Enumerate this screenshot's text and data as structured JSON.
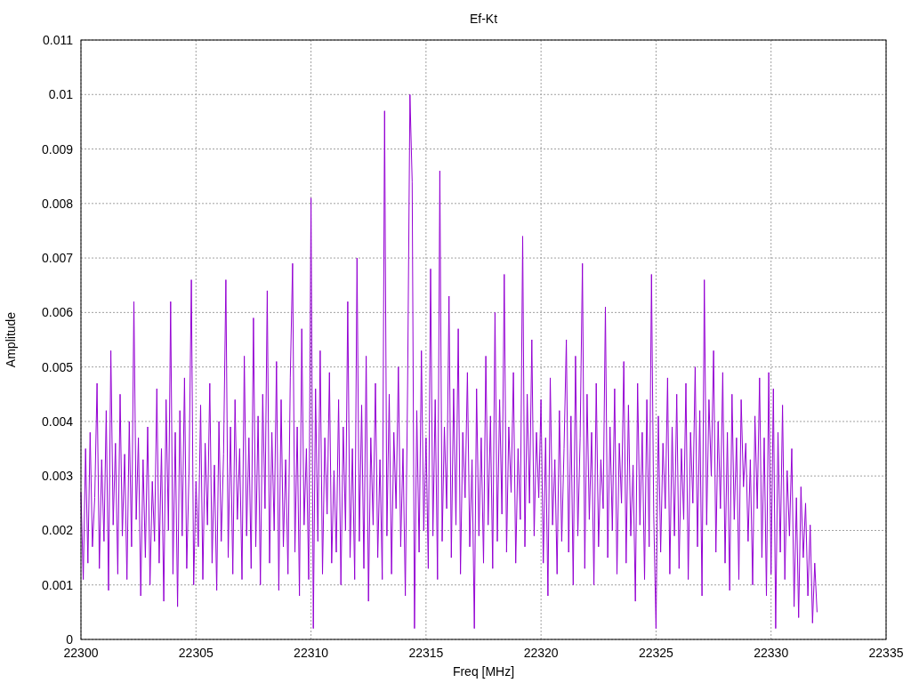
{
  "chart": {
    "chart_data": {
      "type": "line",
      "title": "Ef-Kt",
      "xlabel": "Freq [MHz]",
      "ylabel": "Amplitude",
      "grid": true,
      "xlim": [
        22300,
        22335
      ],
      "ylim": [
        0,
        0.011
      ],
      "xticks": [
        22300,
        22305,
        22310,
        22315,
        22320,
        22325,
        22330,
        22335
      ],
      "yticks": [
        0,
        0.001,
        0.002,
        0.003,
        0.004,
        0.005,
        0.006,
        0.007,
        0.008,
        0.009,
        0.01,
        0.011
      ],
      "x": [
        22300,
        22300.1,
        22300.2,
        22300.3,
        22300.4,
        22300.5,
        22300.6,
        22300.7,
        22300.8,
        22300.9,
        22301,
        22301.1,
        22301.2,
        22301.3,
        22301.4,
        22301.5,
        22301.6,
        22301.7,
        22301.8,
        22301.9,
        22302,
        22302.1,
        22302.2,
        22302.3,
        22302.4,
        22302.5,
        22302.6,
        22302.7,
        22302.8,
        22302.9,
        22303,
        22303.1,
        22303.2,
        22303.3,
        22303.4,
        22303.5,
        22303.6,
        22303.7,
        22303.8,
        22303.9,
        22304,
        22304.1,
        22304.2,
        22304.3,
        22304.4,
        22304.5,
        22304.6,
        22304.7,
        22304.8,
        22304.9,
        22305,
        22305.1,
        22305.2,
        22305.3,
        22305.4,
        22305.5,
        22305.6,
        22305.7,
        22305.8,
        22305.9,
        22306,
        22306.1,
        22306.2,
        22306.3,
        22306.4,
        22306.5,
        22306.6,
        22306.7,
        22306.8,
        22306.9,
        22307,
        22307.1,
        22307.2,
        22307.3,
        22307.4,
        22307.5,
        22307.6,
        22307.7,
        22307.8,
        22307.9,
        22308,
        22308.1,
        22308.2,
        22308.3,
        22308.4,
        22308.5,
        22308.6,
        22308.7,
        22308.8,
        22308.9,
        22309,
        22309.1,
        22309.2,
        22309.3,
        22309.4,
        22309.5,
        22309.6,
        22309.7,
        22309.8,
        22309.9,
        22310,
        22310.1,
        22310.2,
        22310.3,
        22310.4,
        22310.5,
        22310.6,
        22310.7,
        22310.8,
        22310.9,
        22311,
        22311.1,
        22311.2,
        22311.3,
        22311.4,
        22311.5,
        22311.6,
        22311.7,
        22311.8,
        22311.9,
        22312,
        22312.1,
        22312.2,
        22312.3,
        22312.4,
        22312.5,
        22312.6,
        22312.7,
        22312.8,
        22312.9,
        22313,
        22313.1,
        22313.2,
        22313.3,
        22313.4,
        22313.5,
        22313.6,
        22313.7,
        22313.8,
        22313.9,
        22314,
        22314.1,
        22314.2,
        22314.3,
        22314.4,
        22314.5,
        22314.6,
        22314.7,
        22314.8,
        22314.9,
        22315,
        22315.1,
        22315.2,
        22315.3,
        22315.4,
        22315.5,
        22315.6,
        22315.7,
        22315.8,
        22315.9,
        22316,
        22316.1,
        22316.2,
        22316.3,
        22316.4,
        22316.5,
        22316.6,
        22316.7,
        22316.8,
        22316.9,
        22317,
        22317.1,
        22317.2,
        22317.3,
        22317.4,
        22317.5,
        22317.6,
        22317.7,
        22317.8,
        22317.9,
        22318,
        22318.1,
        22318.2,
        22318.3,
        22318.4,
        22318.5,
        22318.6,
        22318.7,
        22318.8,
        22318.9,
        22319,
        22319.1,
        22319.2,
        22319.3,
        22319.4,
        22319.5,
        22319.6,
        22319.7,
        22319.8,
        22319.9,
        22320,
        22320.1,
        22320.2,
        22320.3,
        22320.4,
        22320.5,
        22320.6,
        22320.7,
        22320.8,
        22320.9,
        22321,
        22321.1,
        22321.2,
        22321.3,
        22321.4,
        22321.5,
        22321.6,
        22321.7,
        22321.8,
        22321.9,
        22322,
        22322.1,
        22322.2,
        22322.3,
        22322.4,
        22322.5,
        22322.6,
        22322.7,
        22322.8,
        22322.9,
        22323,
        22323.1,
        22323.2,
        22323.3,
        22323.4,
        22323.5,
        22323.6,
        22323.7,
        22323.8,
        22323.9,
        22324,
        22324.1,
        22324.2,
        22324.3,
        22324.4,
        22324.5,
        22324.6,
        22324.7,
        22324.8,
        22324.9,
        22325,
        22325.1,
        22325.2,
        22325.3,
        22325.4,
        22325.5,
        22325.6,
        22325.7,
        22325.8,
        22325.9,
        22326,
        22326.1,
        22326.2,
        22326.3,
        22326.4,
        22326.5,
        22326.6,
        22326.7,
        22326.8,
        22326.9,
        22327,
        22327.1,
        22327.2,
        22327.3,
        22327.4,
        22327.5,
        22327.6,
        22327.7,
        22327.8,
        22327.9,
        22328,
        22328.1,
        22328.2,
        22328.3,
        22328.4,
        22328.5,
        22328.6,
        22328.7,
        22328.8,
        22328.9,
        22329,
        22329.1,
        22329.2,
        22329.3,
        22329.4,
        22329.5,
        22329.6,
        22329.7,
        22329.8,
        22329.9,
        22330,
        22330.1,
        22330.2,
        22330.3,
        22330.4,
        22330.5,
        22330.6,
        22330.7,
        22330.8,
        22330.9,
        22331,
        22331.1,
        22331.2,
        22331.3,
        22331.4,
        22331.5,
        22331.6,
        22331.7,
        22331.8,
        22331.9,
        22332
      ],
      "series": [
        {
          "color": "#9400d3",
          "values": [
            0.0027,
            0.0011,
            0.0035,
            0.0014,
            0.0038,
            0.0017,
            0.0026,
            0.0047,
            0.0013,
            0.0033,
            0.0018,
            0.0042,
            0.0009,
            0.0053,
            0.0021,
            0.0036,
            0.0012,
            0.0045,
            0.0019,
            0.0034,
            0.0011,
            0.004,
            0.0017,
            0.0062,
            0.0022,
            0.0037,
            0.0008,
            0.0033,
            0.0015,
            0.0039,
            0.001,
            0.0029,
            0.0018,
            0.0046,
            0.0014,
            0.0035,
            0.0007,
            0.0044,
            0.002,
            0.0062,
            0.0012,
            0.0038,
            0.0006,
            0.0042,
            0.0019,
            0.0048,
            0.0013,
            0.0031,
            0.0066,
            0.001,
            0.0029,
            0.0017,
            0.0043,
            0.0011,
            0.0036,
            0.0021,
            0.0047,
            0.0014,
            0.0032,
            0.0009,
            0.004,
            0.0018,
            0.0034,
            0.0066,
            0.0015,
            0.0039,
            0.0012,
            0.0044,
            0.0022,
            0.0035,
            0.0011,
            0.0052,
            0.0019,
            0.0037,
            0.0013,
            0.0059,
            0.0017,
            0.0041,
            0.001,
            0.0045,
            0.0024,
            0.0064,
            0.0014,
            0.0038,
            0.002,
            0.0051,
            0.0009,
            0.0044,
            0.0017,
            0.0033,
            0.0012,
            0.0048,
            0.0069,
            0.0016,
            0.0039,
            0.0008,
            0.0057,
            0.0021,
            0.0035,
            0.0011,
            0.0081,
            0.0002,
            0.0046,
            0.0018,
            0.0053,
            0.0012,
            0.0037,
            0.0023,
            0.0049,
            0.0014,
            0.0031,
            0.0016,
            0.0044,
            0.001,
            0.0039,
            0.002,
            0.0062,
            0.0015,
            0.0035,
            0.0011,
            0.007,
            0.0018,
            0.0043,
            0.0013,
            0.0052,
            0.0007,
            0.0037,
            0.0021,
            0.0047,
            0.0015,
            0.0033,
            0.0011,
            0.0097,
            0.0019,
            0.0045,
            0.0012,
            0.0038,
            0.0024,
            0.005,
            0.0017,
            0.0035,
            0.0008,
            0.0047,
            0.01,
            0.0084,
            0.0002,
            0.0042,
            0.0016,
            0.0053,
            0.002,
            0.0037,
            0.0013,
            0.0068,
            0.0019,
            0.0044,
            0.0011,
            0.0086,
            0.0018,
            0.0039,
            0.0024,
            0.0063,
            0.0015,
            0.0046,
            0.0021,
            0.0057,
            0.0012,
            0.0038,
            0.0026,
            0.0049,
            0.0017,
            0.0033,
            0.0002,
            0.0046,
            0.0019,
            0.0037,
            0.0014,
            0.0052,
            0.0021,
            0.0041,
            0.0013,
            0.006,
            0.0018,
            0.0044,
            0.0023,
            0.0067,
            0.0016,
            0.0039,
            0.0027,
            0.0049,
            0.0014,
            0.0035,
            0.0022,
            0.0074,
            0.0017,
            0.0045,
            0.0025,
            0.0055,
            0.0019,
            0.0038,
            0.0026,
            0.0044,
            0.0014,
            0.0037,
            0.0008,
            0.0048,
            0.0021,
            0.0033,
            0.0012,
            0.0042,
            0.0018,
            0.0035,
            0.0055,
            0.0016,
            0.0041,
            0.001,
            0.0052,
            0.0019,
            0.0037,
            0.0069,
            0.0013,
            0.0045,
            0.0022,
            0.0038,
            0.001,
            0.0047,
            0.0017,
            0.0033,
            0.0024,
            0.0061,
            0.0015,
            0.0039,
            0.002,
            0.0046,
            0.0012,
            0.0036,
            0.0025,
            0.0051,
            0.0014,
            0.0043,
            0.0019,
            0.0032,
            0.0007,
            0.0047,
            0.0021,
            0.0038,
            0.0011,
            0.0044,
            0.0017,
            0.0067,
            0.0023,
            0.0002,
            0.0041,
            0.0016,
            0.0036,
            0.0024,
            0.0048,
            0.0012,
            0.0039,
            0.0019,
            0.0045,
            0.0013,
            0.0035,
            0.0022,
            0.0047,
            0.0011,
            0.0038,
            0.0025,
            0.005,
            0.0017,
            0.0042,
            0.0008,
            0.0066,
            0.0021,
            0.0044,
            0.003,
            0.0053,
            0.0016,
            0.004,
            0.0024,
            0.0049,
            0.0014,
            0.0038,
            0.0009,
            0.0045,
            0.0022,
            0.0037,
            0.0011,
            0.0044,
            0.0028,
            0.0036,
            0.0018,
            0.0033,
            0.001,
            0.0041,
            0.0024,
            0.0048,
            0.0015,
            0.0037,
            0.0008,
            0.0049,
            0.0012,
            0.0046,
            0.0002,
            0.0038,
            0.0016,
            0.0043,
            0.0011,
            0.0031,
            0.0019,
            0.0035,
            0.0006,
            0.0026,
            0.0004,
            0.0028,
            0.0015,
            0.0025,
            0.0008,
            0.0021,
            0.0003,
            0.0014,
            0.0005
          ]
        }
      ]
    }
  }
}
